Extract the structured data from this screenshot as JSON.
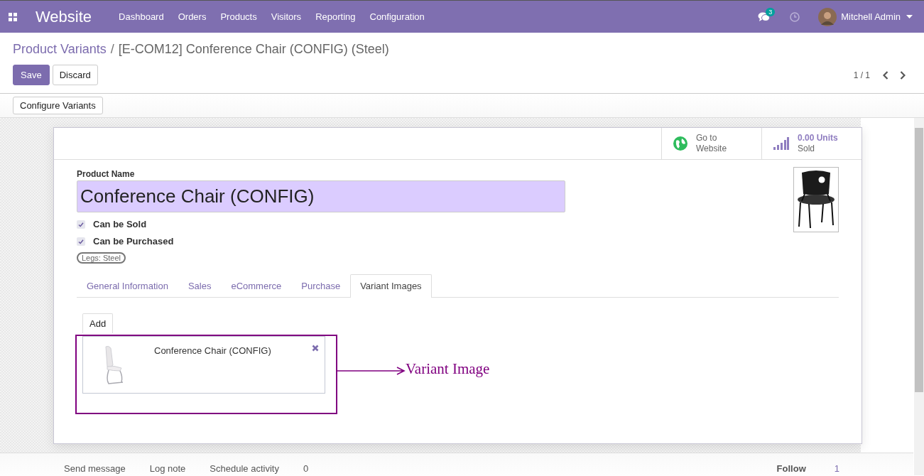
{
  "navbar": {
    "app_title": "Website",
    "menu": [
      "Dashboard",
      "Orders",
      "Products",
      "Visitors",
      "Reporting",
      "Configuration"
    ],
    "messages_badge": "3",
    "user": "Mitchell Admin"
  },
  "breadcrumb": {
    "parent": "Product Variants",
    "separator": "/",
    "current": "[E-COM12] Conference Chair (CONFIG) (Steel)"
  },
  "buttons": [
    {
      "label": "Save",
      "kind": "primary"
    },
    {
      "label": "Discard",
      "kind": "secondary"
    }
  ],
  "pager": "1 / 1",
  "action_buttons": [
    "Configure Variants"
  ],
  "smart_buttons": [
    {
      "kind": "website",
      "value": "Go to",
      "caption": "Website"
    },
    {
      "kind": "sold",
      "value": "0.00 Units",
      "caption": "Sold"
    }
  ],
  "form": {
    "name_label": "Product Name",
    "name": "Conference Chair (CONFIG)",
    "checkboxes": [
      {
        "label": "Can be Sold",
        "checked": true
      },
      {
        "label": "Can be Purchased",
        "checked": true
      }
    ],
    "tags": [
      "Legs: Steel"
    ]
  },
  "tabs": [
    {
      "label": "General Information",
      "selected": false
    },
    {
      "label": "Sales",
      "selected": false
    },
    {
      "label": "eCommerce",
      "selected": false
    },
    {
      "label": "Purchase",
      "selected": false
    },
    {
      "label": "Variant Images",
      "selected": true
    }
  ],
  "variant_images": {
    "add_button": "Add",
    "items": [
      {
        "name": "Conference Chair (CONFIG)",
        "kind": "picture"
      }
    ]
  },
  "annotation": {
    "label": "Variant Image"
  },
  "chatter": {
    "actions": [
      "Send message",
      "Log note",
      "Schedule activity",
      "0"
    ],
    "follow": "Follow",
    "followers": "1"
  }
}
